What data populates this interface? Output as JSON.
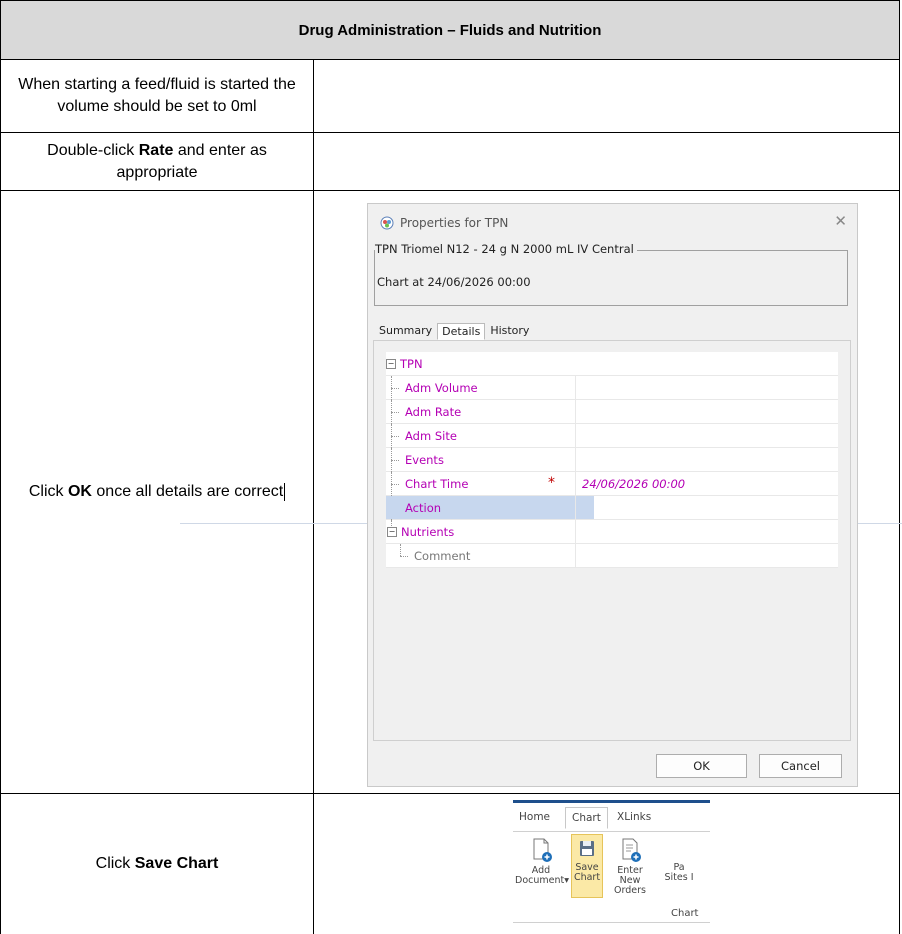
{
  "section_title": "Drug Administration – Fluids and Nutrition",
  "steps": [
    {
      "text_before": "When starting a feed/fluid is started the volume should be set to 0ml",
      "bold": "",
      "text_after": ""
    },
    {
      "text_before": "Double-click ",
      "bold": "Rate",
      "text_after": " and enter as appropriate"
    },
    {
      "text_before": "Click ",
      "bold": "OK",
      "text_after": " once all details are correct"
    },
    {
      "text_before": "Click ",
      "bold": "Save Chart",
      "text_after": ""
    }
  ],
  "dialog": {
    "title": "Properties for TPN",
    "group_title": "TPN Triomel N12 - 24 g N 2000 mL IV Central",
    "chart_at": "Chart at 24/06/2026 00:00",
    "tabs": [
      "Summary",
      "Details",
      "History"
    ],
    "active_tab": "Details",
    "root_node": "TPN",
    "fields": [
      {
        "name": "Adm Volume",
        "value": ""
      },
      {
        "name": "Adm Rate",
        "value": ""
      },
      {
        "name": "Adm Site",
        "value": ""
      },
      {
        "name": "Events",
        "value": ""
      },
      {
        "name": "Chart Time",
        "value": "24/06/2026 00:00",
        "required": true
      },
      {
        "name": "Action",
        "value": "",
        "selected": true
      }
    ],
    "nutrients_node": "Nutrients",
    "comment_label": "Comment",
    "required_marker": "*",
    "ok_label": "OK",
    "cancel_label": "Cancel"
  },
  "ribbon": {
    "tabs": [
      "Home",
      "Chart",
      "XLinks"
    ],
    "active_tab": "Chart",
    "buttons": [
      {
        "line1": "Add",
        "line2": "Document▾"
      },
      {
        "line1": "Save",
        "line2": "Chart"
      },
      {
        "line1": "Enter",
        "line2": "New Orders"
      },
      {
        "line1": "Pa",
        "line2": "Sites I"
      }
    ],
    "group_label": "Chart"
  },
  "colors": {
    "header_bg": "#d9d9d9",
    "field_text": "#b400b4",
    "selected_row": "#c7d7ee",
    "required_star": "#c00000",
    "ribbon_accent": "#1e4f8c",
    "save_highlight": "#fbe9a6"
  }
}
